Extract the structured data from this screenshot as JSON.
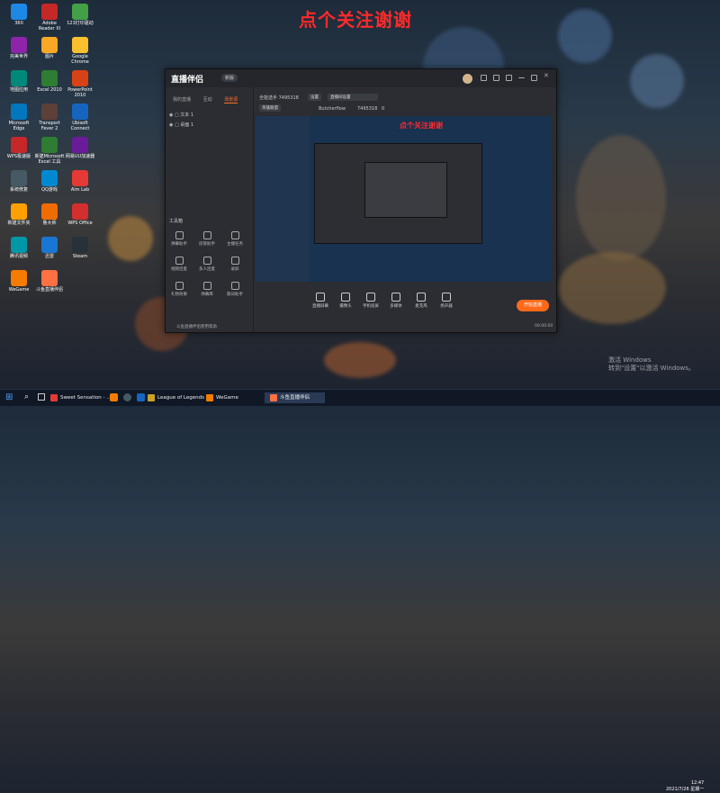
{
  "overlay_text": "点个关注谢谢",
  "desktop_icons": [
    {
      "label": "360",
      "color": "#1e88e5"
    },
    {
      "label": "Adobe Reader XI",
      "color": "#c62828"
    },
    {
      "label": "123打印驱动",
      "color": "#43a047"
    },
    {
      "label": "完美世界",
      "color": "#8e24aa"
    },
    {
      "label": "图片",
      "color": "#f9a825"
    },
    {
      "label": "Google Chrome",
      "color": "#fbc02d"
    },
    {
      "label": "地图应用",
      "color": "#00897b"
    },
    {
      "label": "Excel 2010",
      "color": "#2e7d32"
    },
    {
      "label": "PowerPoint 2010",
      "color": "#d84315"
    },
    {
      "label": "Microsoft Edge",
      "color": "#0277bd"
    },
    {
      "label": "Transport Fever 2",
      "color": "#5d4037"
    },
    {
      "label": "Ubisoft Connect",
      "color": "#1565c0"
    },
    {
      "label": "WPS极速版",
      "color": "#c62828"
    },
    {
      "label": "新建Microsoft Excel 工具",
      "color": "#2e7d32"
    },
    {
      "label": "网易UU加速器",
      "color": "#6a1b9a"
    },
    {
      "label": "系统修复",
      "color": "#455a64"
    },
    {
      "label": "QQ游戏",
      "color": "#0288d1"
    },
    {
      "label": "Aim Lab",
      "color": "#e53935"
    },
    {
      "label": "新建文件夹",
      "color": "#ffa000"
    },
    {
      "label": "鲁大师",
      "color": "#ef6c00"
    },
    {
      "label": "WPS Office",
      "color": "#d32f2f"
    },
    {
      "label": "腾讯视频",
      "color": "#0097a7"
    },
    {
      "label": "迅雷",
      "color": "#1976d2"
    },
    {
      "label": "Steam",
      "color": "#263238"
    },
    {
      "label": "WeGame",
      "color": "#f57c00"
    },
    {
      "label": "斗鱼直播伴侣",
      "color": "#ff7043"
    }
  ],
  "app": {
    "logo": "直播伴侣",
    "badge": "新版",
    "left_tabs": [
      "我的直播",
      "互动",
      "场景源"
    ],
    "scenes": [
      "文本 1",
      "桌面 1"
    ],
    "tools_title": "工具箱",
    "tools": [
      "弹幕助手",
      "房管助手",
      "主播任务",
      "视频连麦",
      "多人连麦",
      "录屏",
      "礼物效果",
      "弹幕库",
      "歌词助手"
    ],
    "room": {
      "label": "全能选手 7495318",
      "chip1": "设置",
      "chip2": "直播间设置",
      "category": "英雄联盟",
      "streamer": "Butcherflow",
      "room_id": "7495318",
      "viewers": "0"
    },
    "bottom_tools": [
      "直播屏幕",
      "摄像头",
      "手机投屏",
      "多媒体",
      "麦克风",
      "扬声器"
    ],
    "start_live": "开始直播",
    "status": "斗鱼直播伴侣使用帮助",
    "timer": "00:00:00"
  },
  "taskbar": {
    "items": [
      "Sweet Sensation - ...",
      "League of Legends",
      "WeGame",
      "斗鱼直播伴侣"
    ],
    "time": "12:47",
    "date": "2021/7/26 星期一"
  },
  "activation": {
    "line1": "激活 Windows",
    "line2": "转到\"设置\"以激活 Windows。"
  }
}
